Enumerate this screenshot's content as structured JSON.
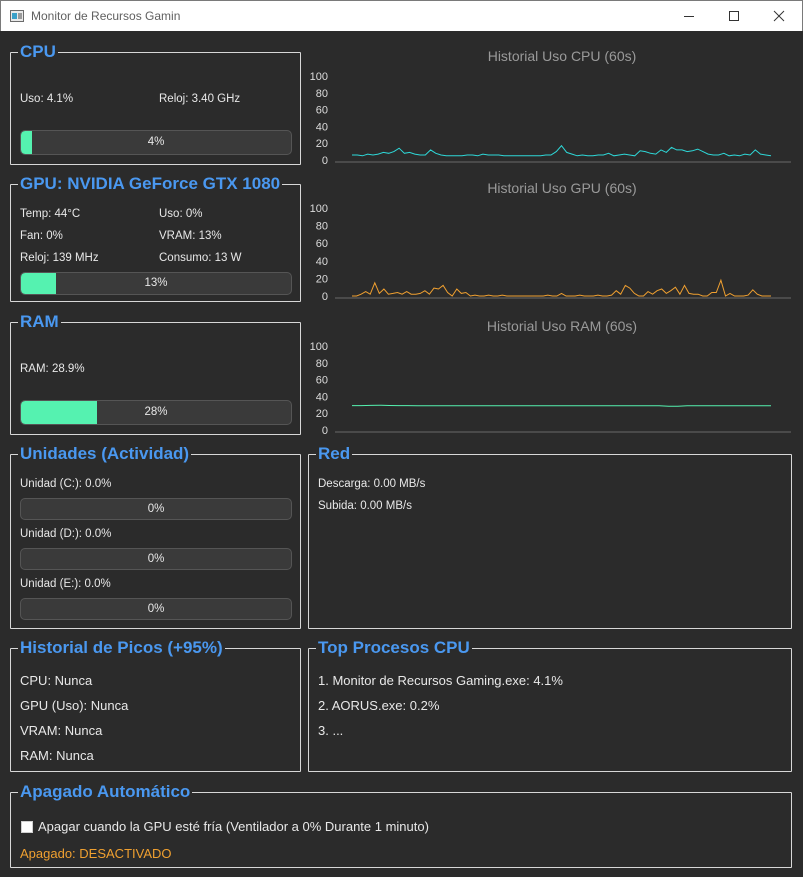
{
  "window": {
    "title": "Monitor de Recursos Gamin"
  },
  "cpu": {
    "legend": "CPU",
    "uso": "Uso: 4.1%",
    "reloj": "Reloj: 3.40 GHz",
    "bar_text": "4%",
    "bar_fraction": 0.04
  },
  "gpu": {
    "legend": "GPU: NVIDIA GeForce GTX 1080",
    "temp": "Temp: 44°C",
    "uso": "Uso: 0%",
    "fan": "Fan: 0%",
    "vram": "VRAM: 13%",
    "reloj": "Reloj: 139 MHz",
    "consumo": "Consumo: 13 W",
    "bar_text": "13%",
    "bar_fraction": 0.13
  },
  "ram": {
    "legend": "RAM",
    "value": "RAM: 28.9%",
    "bar_text": "28%",
    "bar_fraction": 0.28
  },
  "drives": {
    "legend": "Unidades (Actividad)",
    "items": [
      {
        "label": "Unidad (C:): 0.0%",
        "bar_text": "0%",
        "bar_fraction": 0
      },
      {
        "label": "Unidad (D:): 0.0%",
        "bar_text": "0%",
        "bar_fraction": 0
      },
      {
        "label": "Unidad (E:): 0.0%",
        "bar_text": "0%",
        "bar_fraction": 0
      }
    ]
  },
  "network": {
    "legend": "Red",
    "download": "Descarga: 0.00 MB/s",
    "upload": "Subida: 0.00 MB/s"
  },
  "peaks": {
    "legend": "Historial de Picos (+95%)",
    "items": [
      "CPU: Nunca",
      "GPU (Uso): Nunca",
      "VRAM: Nunca",
      "RAM: Nunca"
    ]
  },
  "top_processes": {
    "legend": "Top Procesos CPU",
    "items": [
      "1. Monitor de Recursos Gaming.exe: 4.1%",
      "2. AORUS.exe: 0.2%",
      "3. ..."
    ]
  },
  "shutdown": {
    "legend": "Apagado Automático",
    "checkbox_label": "Apagar cuando la GPU esté fría (Ventilador a 0% Durante 1 minuto)",
    "checked": false,
    "status": "Apagado: DESACTIVADO"
  },
  "chart_data": [
    {
      "type": "line",
      "title": "Historial Uso CPU (60s)",
      "ylim": [
        0,
        100
      ],
      "yticks": [
        "100",
        "80",
        "60",
        "40",
        "20",
        "0"
      ],
      "color": "#2ed8d8",
      "series": [
        {
          "values": [
            6,
            6,
            5,
            7,
            6,
            7,
            9,
            8,
            10,
            14,
            8,
            9,
            7,
            6,
            6,
            12,
            8,
            6,
            5,
            5,
            5,
            5,
            6,
            6,
            5,
            7,
            6,
            6,
            6,
            5,
            5,
            5,
            5,
            5,
            5,
            5,
            5,
            6,
            6,
            10,
            17,
            9,
            7,
            5,
            6,
            5,
            5,
            6,
            6,
            8,
            5,
            6,
            7,
            6,
            5,
            11,
            10,
            8,
            7,
            12,
            9,
            15,
            12,
            12,
            10,
            11,
            13,
            10,
            7,
            6,
            6,
            8,
            5,
            6,
            5,
            7,
            6,
            12,
            7,
            6,
            5
          ]
        }
      ]
    },
    {
      "type": "line",
      "title": "Historial Uso GPU (60s)",
      "ylim": [
        0,
        100
      ],
      "yticks": [
        "100",
        "80",
        "60",
        "40",
        "20",
        "0"
      ],
      "color": "#f0a030",
      "series": [
        {
          "values": [
            0,
            0,
            2,
            5,
            2,
            15,
            3,
            8,
            2,
            3,
            4,
            2,
            5,
            2,
            2,
            3,
            6,
            2,
            9,
            8,
            12,
            4,
            0,
            8,
            3,
            4,
            0,
            1,
            0,
            0,
            1,
            0,
            0,
            1,
            0,
            0,
            0,
            0,
            0,
            0,
            0,
            0,
            0,
            1,
            0,
            0,
            3,
            0,
            0,
            0,
            1,
            0,
            0,
            0,
            1,
            0,
            0,
            1,
            6,
            2,
            12,
            9,
            3,
            0,
            0,
            5,
            2,
            6,
            8,
            3,
            6,
            10,
            2,
            12,
            3,
            2,
            2,
            0,
            0,
            4,
            4,
            18,
            0,
            3,
            0,
            0,
            0,
            1,
            7,
            2,
            0,
            0,
            0
          ]
        }
      ]
    },
    {
      "type": "line",
      "title": "Historial Uso RAM (60s)",
      "ylim": [
        0,
        100
      ],
      "yticks": [
        "100",
        "80",
        "60",
        "40",
        "20",
        "0"
      ],
      "color": "#55f2b0",
      "series": [
        {
          "values": [
            29,
            29,
            29.3,
            29.5,
            29.2,
            29,
            29,
            28.8,
            28.8,
            28.8,
            28.8,
            28.8,
            28.8,
            28.8,
            28.8,
            28.8,
            28.8,
            28.9,
            28.9,
            28.9,
            28.9,
            28.8,
            28.8,
            28.8,
            28.8,
            28.8,
            28.8,
            28.8,
            28.8,
            28.8,
            28.8,
            28.8,
            28.8,
            28.8,
            28.3,
            28.3,
            28.8,
            28.8,
            28.8,
            28.8,
            28.8,
            28.8,
            28.8,
            28.8,
            28.8,
            28.9
          ]
        }
      ]
    }
  ]
}
